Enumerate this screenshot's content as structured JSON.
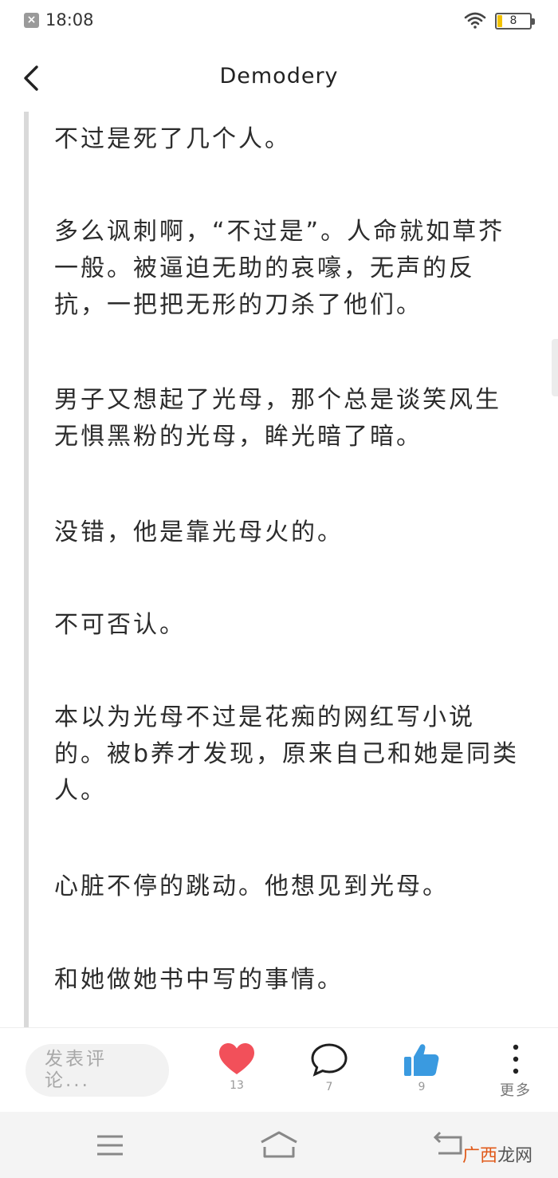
{
  "status_bar": {
    "time": "18:08",
    "battery_level": "8",
    "app_icon": "x-icon"
  },
  "header": {
    "title": "Demodery",
    "back_icon": "chevron-left-icon"
  },
  "content": {
    "paragraphs": [
      "不过是死了几个人。",
      "多么讽刺啊，“不过是”。人命就如草芥一般。被逼迫无助的哀嚎，无声的反抗，一把把无形的刀杀了他们。",
      "男子又想起了光母，那个总是谈笑风生无惧黑粉的光母，眸光暗了暗。",
      "没错，他是靠光母火的。",
      "不可否认。",
      "本以为光母不过是花痴的网红写小说的。被b养才发现，原来自己和她是同类人。",
      "心脏不停的跳动。他想见到光母。",
      "和她做她书中写的事情。"
    ]
  },
  "action_bar": {
    "comment_placeholder": "发表评论...",
    "heart_count": "13",
    "comment_count": "7",
    "like_count": "9",
    "more_label": "更多",
    "heart_color": "#f2505a",
    "like_color": "#3a9ae0"
  },
  "watermark": {
    "part1": "广西",
    "part2": "龙网"
  }
}
